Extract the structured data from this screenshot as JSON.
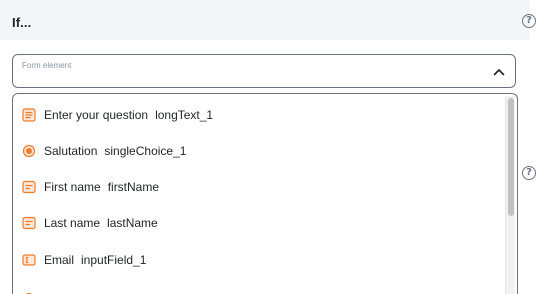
{
  "condition": {
    "title": "If..."
  },
  "field_select": {
    "label": "Form element",
    "value": ""
  },
  "icons": {
    "help": "help-circle-icon",
    "chevron": "chevron-up-icon",
    "accent_color": "#f07a2a"
  },
  "options": [
    {
      "label": "Enter your question",
      "key": "longText_1",
      "icon": "long-text-icon"
    },
    {
      "label": "Salutation",
      "key": "singleChoice_1",
      "icon": "radio-icon"
    },
    {
      "label": "First name",
      "key": "firstName",
      "icon": "short-text-icon"
    },
    {
      "label": "Last name",
      "key": "lastName",
      "icon": "short-text-icon"
    },
    {
      "label": "Email",
      "key": "inputField_1",
      "icon": "input-field-icon"
    }
  ]
}
